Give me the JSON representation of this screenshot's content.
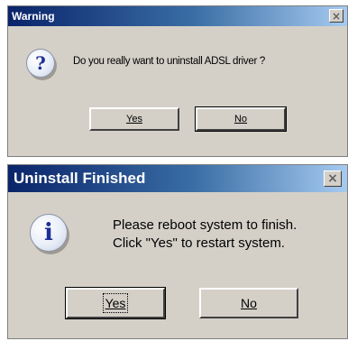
{
  "warning_dialog": {
    "title": "Warning",
    "icon": "question-icon",
    "icon_glyph": "?",
    "message": "Do you really want to uninstall ADSL driver ?",
    "buttons": {
      "yes": "Yes",
      "no": "No"
    },
    "close_glyph": "×"
  },
  "finished_dialog": {
    "title": "Uninstall Finished",
    "icon": "info-icon",
    "icon_glyph": "i",
    "message_line1": "Please reboot system to finish.",
    "message_line2": "Click \"Yes\" to restart system.",
    "buttons": {
      "yes": "Yes",
      "no": "No"
    },
    "close_glyph": "×"
  },
  "colors": {
    "titlebar_start": "#0a246a",
    "titlebar_end": "#a6caf0",
    "face": "#d4d0c8"
  }
}
